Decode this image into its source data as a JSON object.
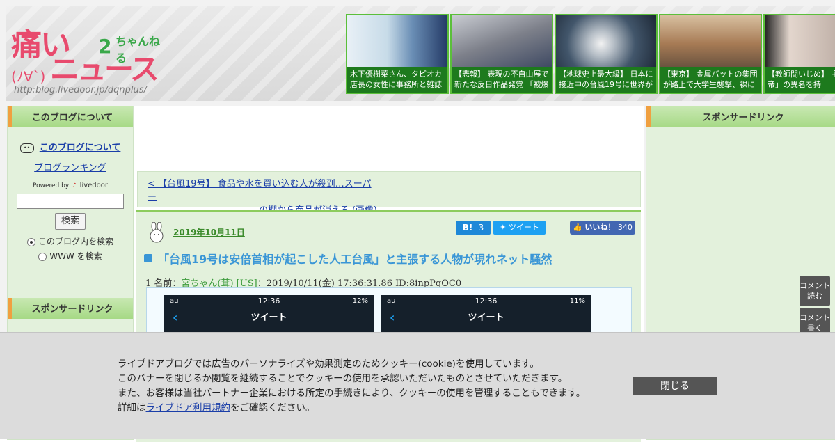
{
  "header": {
    "logo": {
      "kanji": "痛い",
      "face": "(ﾉ∀`)",
      "news": "ニュース",
      "chan": "ちゃんねる",
      "url": "http:blog.livedoor.jp/dqnplus/"
    },
    "thumbs": [
      {
        "caption": "木下優樹菜さん、タピオカ店長の女性に事務所と雑誌",
        "color": "#9ab7d0"
      },
      {
        "caption": "【悲報】 表現の不自由展で新たな反日作品発覚 「被爆",
        "color": "#8c8f99"
      },
      {
        "caption": "【地球史上最大級】 日本に接近中の台風19号に世界が",
        "color": "#3b4f66"
      },
      {
        "caption": "【東京】 金属バットの集団が路上で大学生襲撃、裸に",
        "color": "#b08b6a"
      },
      {
        "caption": "【教師間いじめ】 主「女帝」の異名を持",
        "color": "#c8b9b0"
      }
    ]
  },
  "left": {
    "about_heading": "このブログについて",
    "about_link": "このブログについて",
    "ranking_link": "ブログランキング",
    "powered": "Powered by",
    "livedoor": "livedoor",
    "search_button": "検索",
    "radio_blog": "このブログ内を検索",
    "radio_www": "WWW を検索",
    "sponsor_heading": "スポンサードリンク"
  },
  "center": {
    "prev_line1": "< 【台風19号】 食品や水を買い込む人が殺到…スーパー",
    "prev_line2": "の棚から商品が消える (画像)",
    "date": "2019年10月11日",
    "hatena_label": "B!",
    "hatena_count": "3",
    "tweet_label": "ツイート",
    "like_label": "いいね！",
    "like_count": "340",
    "title": "「台風19号は安倍首相が起こした人工台風」と主張する人物が現れネット騒然",
    "post_no": "1 名前：",
    "post_name": "宮ちゃん(茸) [US]",
    "post_meta": "：2019/10/11(金) 17:36:31.86 ID:8inpPqOC0",
    "phones": [
      {
        "carrier": "au",
        "time": "12:36",
        "battery": "12%",
        "title": "ツイート"
      },
      {
        "carrier": "au",
        "time": "12:36",
        "battery": "11%",
        "title": "ツイート"
      }
    ]
  },
  "right": {
    "sponsor_heading": "スポンサードリンク",
    "comment_read": "コメント読む",
    "comment_write": "コメント書く"
  },
  "cookie": {
    "line1": "ライブドアブログでは広告のパーソナライズや効果測定のためクッキー(cookie)を使用しています。",
    "line2": "このバナーを閉じるか閲覧を継続することでクッキーの使用を承認いただいたものとさせていただきます。",
    "line3": "また、お客様は当社パートナー企業における所定の手続きにより、クッキーの使用を管理することもできます。",
    "line4_prefix": "詳細は",
    "line4_link": "ライブドア利用規約",
    "line4_suffix": "をご確認ください。",
    "close_label": "閉じる"
  }
}
